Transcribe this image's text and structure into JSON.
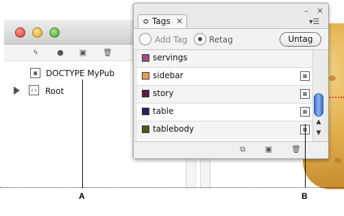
{
  "document_window": {
    "structure": [
      {
        "icon": "doctype-icon",
        "label": "DOCTYPE MyPub"
      },
      {
        "icon": "element-icon",
        "label": "Root"
      }
    ]
  },
  "tags_panel": {
    "title": "Tags",
    "add_tag_label": "Add Tag",
    "retag_label": "Retag",
    "untag_label": "Untag",
    "selected_mode": "Retag",
    "tags": [
      {
        "name": "servings",
        "color": "#a14d83"
      },
      {
        "name": "sidebar",
        "color": "#e89a55"
      },
      {
        "name": "story",
        "color": "#5b1d44"
      },
      {
        "name": "table",
        "color": "#23235e"
      },
      {
        "name": "tablebody",
        "color": "#4a5a1f"
      }
    ]
  },
  "callouts": {
    "a": "A",
    "b": "B"
  }
}
